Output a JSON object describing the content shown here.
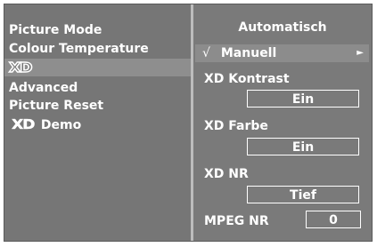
{
  "left_menu": {
    "items": [
      {
        "label": "Picture Mode"
      },
      {
        "label": "Colour Temperature"
      },
      {
        "logo_text": "XD"
      },
      {
        "label": "Advanced"
      },
      {
        "label": "Picture Reset"
      },
      {
        "logo_text": "XD",
        "label": "Demo"
      }
    ],
    "selected_index": 2
  },
  "right_panel": {
    "title": "Automatisch",
    "selected_option": {
      "check": "√",
      "label": "Manuell",
      "arrow": "►"
    },
    "settings": [
      {
        "label": "XD Kontrast",
        "value": "Ein"
      },
      {
        "label": "XD Farbe",
        "value": "Ein"
      },
      {
        "label": "XD NR",
        "value": "Tief"
      }
    ],
    "mpeg": {
      "label": "MPEG NR",
      "value": "0"
    }
  },
  "colors": {
    "panel_bg": "#767676",
    "highlight_bg": "#8c8c8c",
    "divider": "#bdbdbd",
    "text": "#ffffff"
  }
}
